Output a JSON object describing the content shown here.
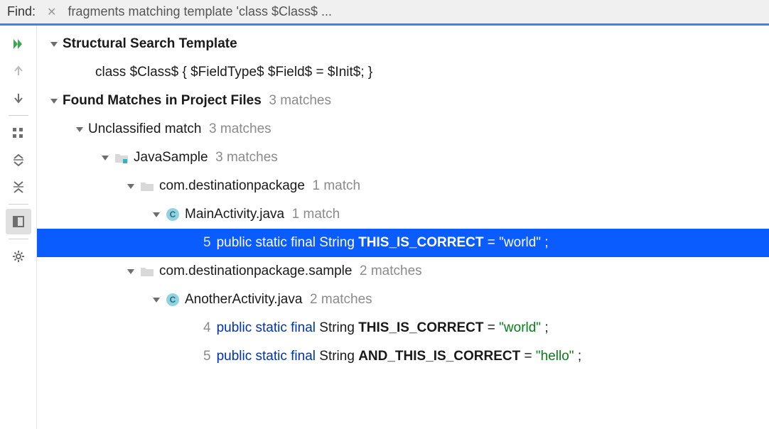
{
  "topbar": {
    "find_label": "Find:",
    "search_text": "fragments matching template 'class $Class$ ..."
  },
  "tree": {
    "template_header": "Structural Search Template",
    "template_body": "class $Class$ {    $FieldType$ $Field$ = $Init$; }",
    "found_header": "Found Matches in Project Files",
    "found_count": "3 matches",
    "unclassified_label": "Unclassified match",
    "unclassified_count": "3 matches",
    "module_label": "JavaSample",
    "module_count": "3 matches",
    "pkg1_label": "com.destinationpackage",
    "pkg1_count": "1 match",
    "file1_label": "MainActivity.java",
    "file1_count": "1 match",
    "match1": {
      "line": "5",
      "kw": "public static final",
      "type": "String",
      "ident": "THIS_IS_CORRECT",
      "eq": " = ",
      "str": "\"world\"",
      "semi": ";"
    },
    "pkg2_label": "com.destinationpackage.sample",
    "pkg2_count": "2 matches",
    "file2_label": "AnotherActivity.java",
    "file2_count": "2 matches",
    "match2": {
      "line": "4",
      "kw": "public static final",
      "type": "String",
      "ident": "THIS_IS_CORRECT",
      "eq": " = ",
      "str": "\"world\"",
      "semi": ";"
    },
    "match3": {
      "line": "5",
      "kw": "public static final",
      "type": "String",
      "ident": "AND_THIS_IS_CORRECT",
      "eq": " = ",
      "str": "\"hello\"",
      "semi": ";"
    }
  }
}
